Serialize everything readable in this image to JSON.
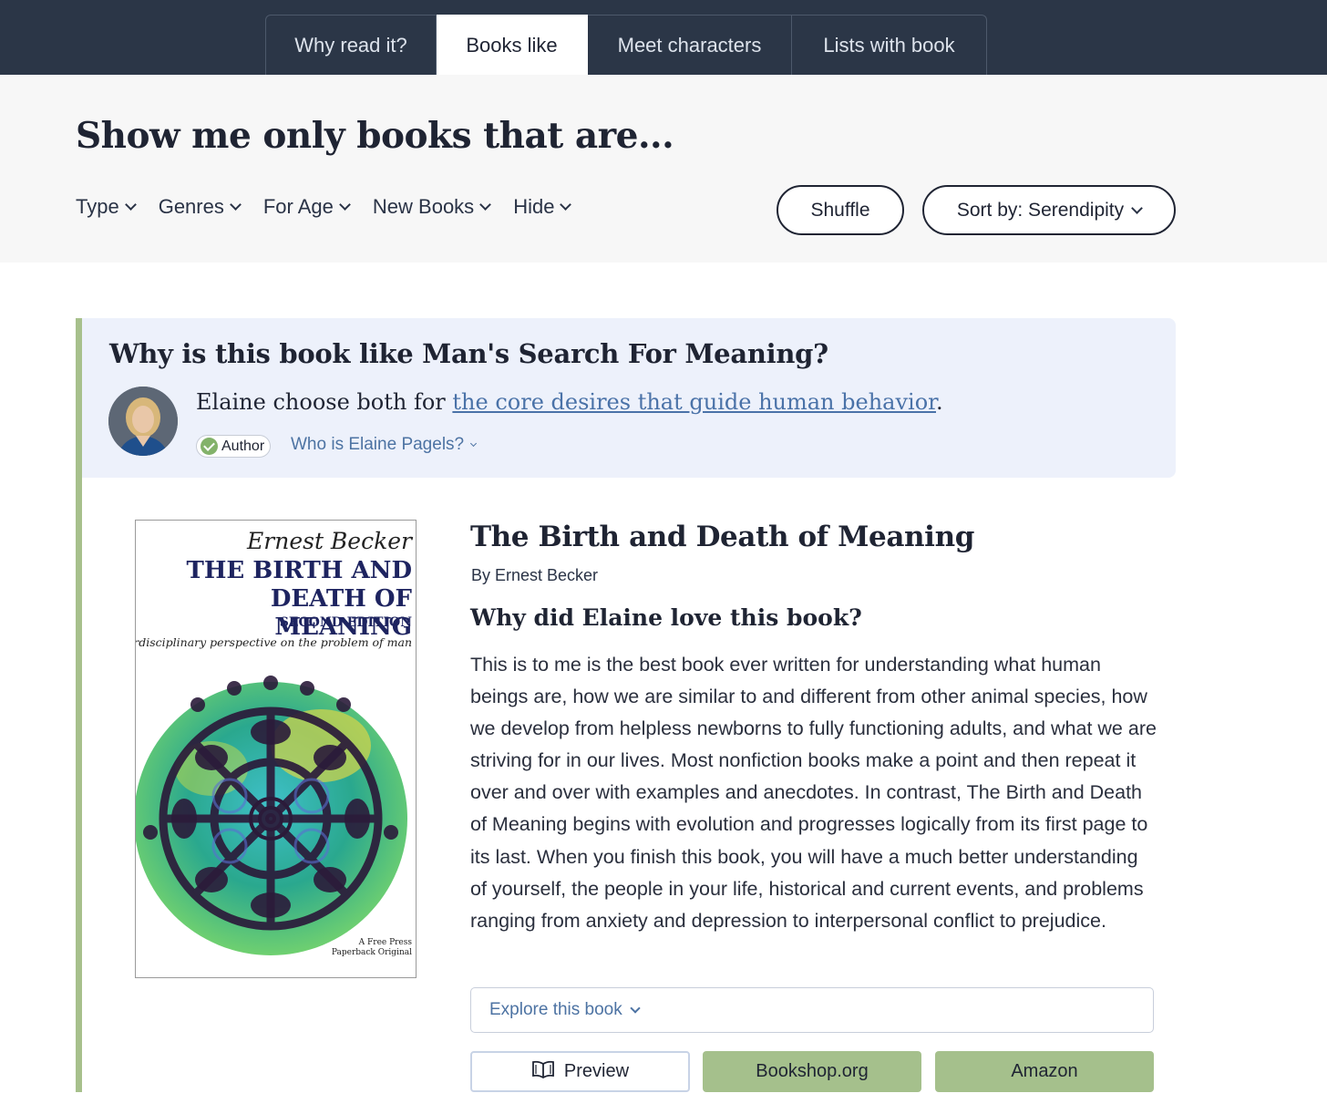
{
  "tabs": [
    {
      "label": "Why read it?",
      "active": false
    },
    {
      "label": "Books like",
      "active": true
    },
    {
      "label": "Meet characters",
      "active": false
    },
    {
      "label": "Lists with book",
      "active": false
    }
  ],
  "filters": {
    "title": "Show me only books that are...",
    "items": [
      "Type",
      "Genres",
      "For Age",
      "New Books",
      "Hide"
    ],
    "shuffle_label": "Shuffle",
    "sort_label": "Sort by: Serendipity"
  },
  "why": {
    "title": "Why is this book like Man's Search For Meaning?",
    "line_prefix": "Elaine choose both for ",
    "line_link": "the core desires that guide human behavior",
    "line_suffix": ".",
    "badge": "Author",
    "who": "Who is Elaine Pagels?"
  },
  "cover": {
    "author": "Ernest  Becker",
    "title": "THE  BIRTH  AND\nDEATH OF MEANING",
    "edition": "SECOND EDITION",
    "subtitle": "An interdisciplinary perspective on the problem of man",
    "publisher": "A Free Press\nPaperback Original"
  },
  "book": {
    "title": "The Birth and Death of Meaning",
    "author": "By Ernest Becker",
    "love_title": "Why did Elaine love this book?",
    "review": "This is to me is the best book ever written for understanding what human beings are, how we are similar to and different from other animal species, how we develop from helpless newborns to fully functioning adults, and what we are striving for in our lives. Most nonfiction books make a point and then repeat it over and over with examples and anecdotes. In contrast, The Birth and Death of Meaning begins with evolution and progresses logically from its first page to its last. When you finish this book, you will have a much better understanding of yourself, the people in your life, historical and current events, and problems ranging from anxiety and depression to interpersonal conflict to prejudice."
  },
  "actions": {
    "explore_label": "Explore this book",
    "preview_label": "Preview",
    "bookshop_label": "Bookshop.org",
    "amazon_label": "Amazon"
  },
  "colors": {
    "header_bg": "#2b3647",
    "accent_green": "#a5c08c",
    "link_blue": "#4a72a8",
    "why_box_bg": "#edf1fb"
  },
  "icons": [
    "chevron-down-icon",
    "check-circle-icon",
    "open-book-icon"
  ]
}
